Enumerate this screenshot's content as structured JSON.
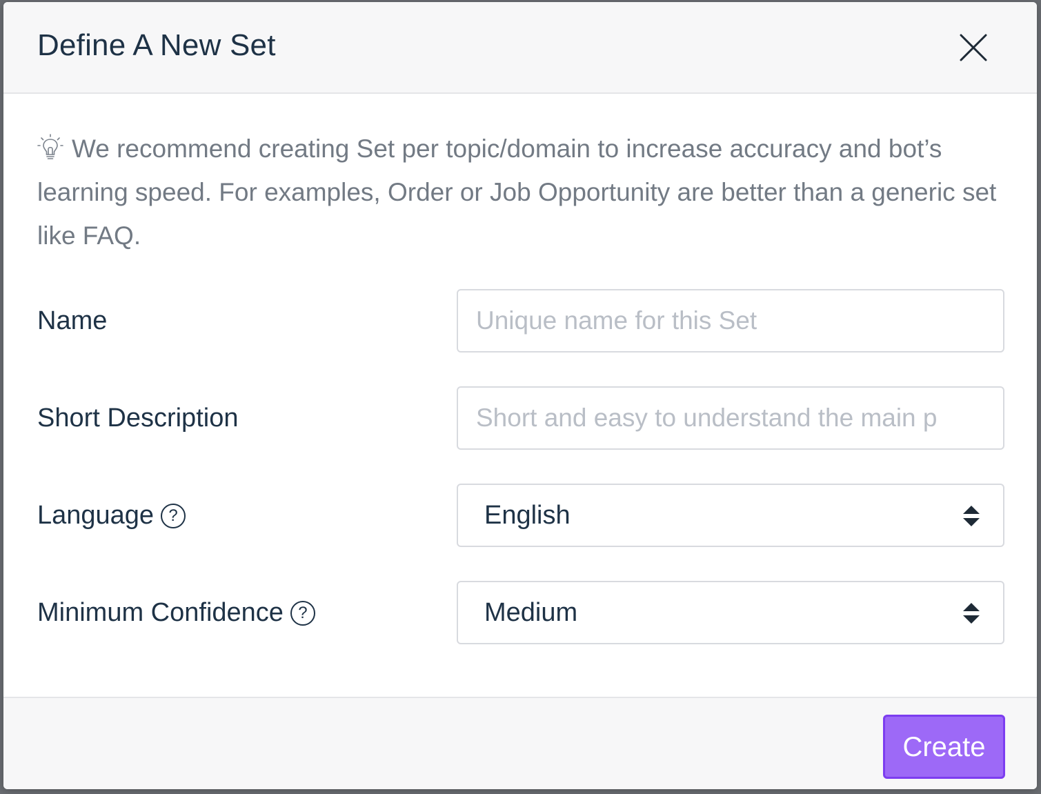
{
  "modal": {
    "title": "Define A New Set",
    "close_icon": "close-icon"
  },
  "tip": {
    "icon": "lightbulb-icon",
    "text": "We recommend creating Set per topic/domain to increase accuracy and bot’s learning speed. For examples, Order or Job Opportunity are better than a generic set like FAQ."
  },
  "form": {
    "name": {
      "label": "Name",
      "value": "",
      "placeholder": "Unique name for this Set"
    },
    "description": {
      "label": "Short Description",
      "value": "",
      "placeholder": "Short and easy to understand the main p"
    },
    "language": {
      "label": "Language",
      "help_icon": "question-circle-icon",
      "help_glyph": "?",
      "selected": "English"
    },
    "confidence": {
      "label": "Minimum Confidence",
      "help_icon": "question-circle-icon",
      "help_glyph": "?",
      "selected": "Medium"
    }
  },
  "footer": {
    "create_label": "Create"
  },
  "colors": {
    "accent": "#9d69f7",
    "accent_border": "#7c3df0",
    "text_primary": "#1e3246",
    "text_muted": "#727a84",
    "placeholder": "#b9bec6"
  }
}
